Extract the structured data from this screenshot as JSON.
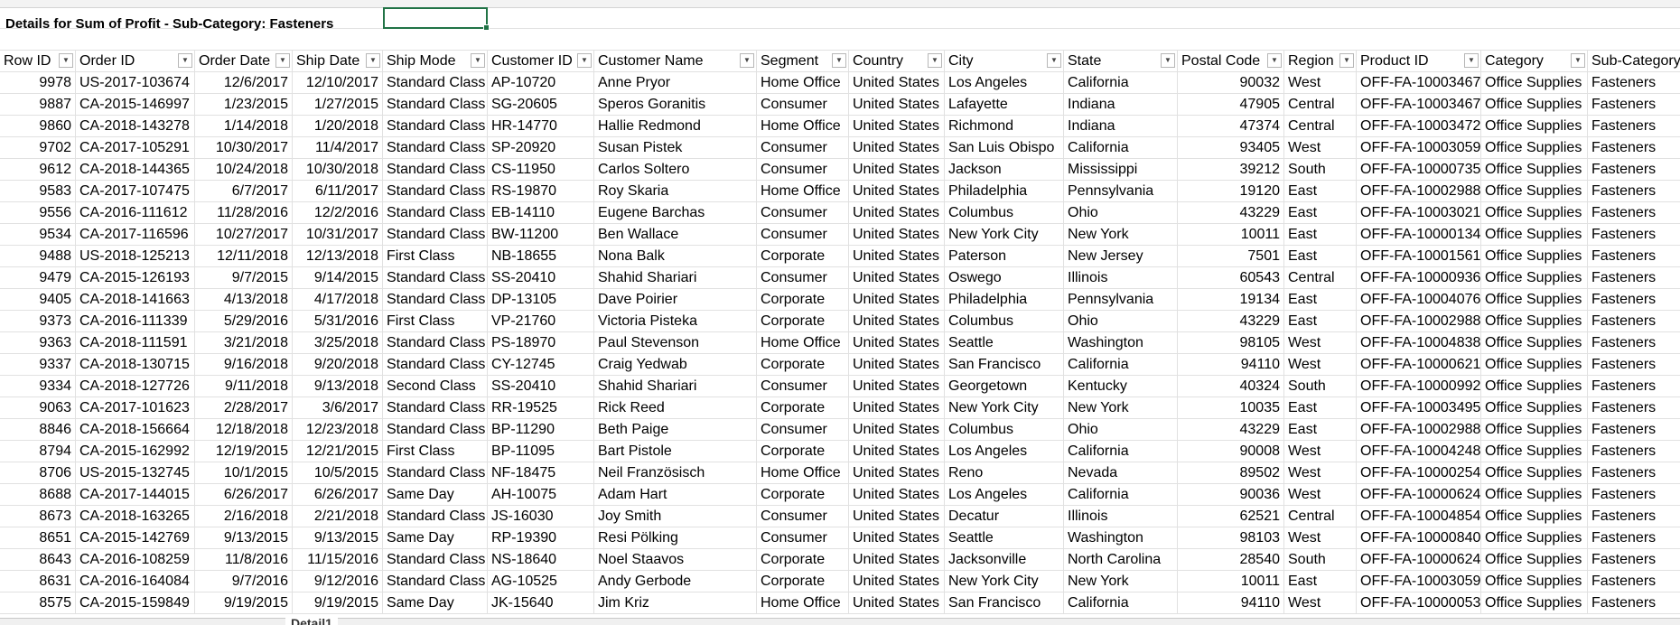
{
  "report": {
    "title": "Details for Sum of Profit - Sub-Category: Fasteners"
  },
  "columns": [
    "Row ID",
    "Order ID",
    "Order Date",
    "Ship Date",
    "Ship Mode",
    "Customer ID",
    "Customer Name",
    "Segment",
    "Country",
    "City",
    "State",
    "Postal Code",
    "Region",
    "Product ID",
    "Category",
    "Sub-Category"
  ],
  "rows": [
    [
      "9978",
      "US-2017-103674",
      "12/6/2017",
      "12/10/2017",
      "Standard Class",
      "AP-10720",
      "Anne Pryor",
      "Home Office",
      "United States",
      "Los Angeles",
      "California",
      "90032",
      "West",
      "OFF-FA-10003467",
      "Office Supplies",
      "Fasteners"
    ],
    [
      "9887",
      "CA-2015-146997",
      "1/23/2015",
      "1/27/2015",
      "Standard Class",
      "SG-20605",
      "Speros Goranitis",
      "Consumer",
      "United States",
      "Lafayette",
      "Indiana",
      "47905",
      "Central",
      "OFF-FA-10003467",
      "Office Supplies",
      "Fasteners"
    ],
    [
      "9860",
      "CA-2018-143278",
      "1/14/2018",
      "1/20/2018",
      "Standard Class",
      "HR-14770",
      "Hallie Redmond",
      "Home Office",
      "United States",
      "Richmond",
      "Indiana",
      "47374",
      "Central",
      "OFF-FA-10003472",
      "Office Supplies",
      "Fasteners"
    ],
    [
      "9702",
      "CA-2017-105291",
      "10/30/2017",
      "11/4/2017",
      "Standard Class",
      "SP-20920",
      "Susan Pistek",
      "Consumer",
      "United States",
      "San Luis Obispo",
      "California",
      "93405",
      "West",
      "OFF-FA-10003059",
      "Office Supplies",
      "Fasteners"
    ],
    [
      "9612",
      "CA-2018-144365",
      "10/24/2018",
      "10/30/2018",
      "Standard Class",
      "CS-11950",
      "Carlos Soltero",
      "Consumer",
      "United States",
      "Jackson",
      "Mississippi",
      "39212",
      "South",
      "OFF-FA-10000735",
      "Office Supplies",
      "Fasteners"
    ],
    [
      "9583",
      "CA-2017-107475",
      "6/7/2017",
      "6/11/2017",
      "Standard Class",
      "RS-19870",
      "Roy Skaria",
      "Home Office",
      "United States",
      "Philadelphia",
      "Pennsylvania",
      "19120",
      "East",
      "OFF-FA-10002988",
      "Office Supplies",
      "Fasteners"
    ],
    [
      "9556",
      "CA-2016-111612",
      "11/28/2016",
      "12/2/2016",
      "Standard Class",
      "EB-14110",
      "Eugene Barchas",
      "Consumer",
      "United States",
      "Columbus",
      "Ohio",
      "43229",
      "East",
      "OFF-FA-10003021",
      "Office Supplies",
      "Fasteners"
    ],
    [
      "9534",
      "CA-2017-116596",
      "10/27/2017",
      "10/31/2017",
      "Standard Class",
      "BW-11200",
      "Ben Wallace",
      "Consumer",
      "United States",
      "New York City",
      "New York",
      "10011",
      "East",
      "OFF-FA-10000134",
      "Office Supplies",
      "Fasteners"
    ],
    [
      "9488",
      "US-2018-125213",
      "12/11/2018",
      "12/13/2018",
      "First Class",
      "NB-18655",
      "Nona Balk",
      "Corporate",
      "United States",
      "Paterson",
      "New Jersey",
      "7501",
      "East",
      "OFF-FA-10001561",
      "Office Supplies",
      "Fasteners"
    ],
    [
      "9479",
      "CA-2015-126193",
      "9/7/2015",
      "9/14/2015",
      "Standard Class",
      "SS-20410",
      "Shahid Shariari",
      "Consumer",
      "United States",
      "Oswego",
      "Illinois",
      "60543",
      "Central",
      "OFF-FA-10000936",
      "Office Supplies",
      "Fasteners"
    ],
    [
      "9405",
      "CA-2018-141663",
      "4/13/2018",
      "4/17/2018",
      "Standard Class",
      "DP-13105",
      "Dave Poirier",
      "Corporate",
      "United States",
      "Philadelphia",
      "Pennsylvania",
      "19134",
      "East",
      "OFF-FA-10004076",
      "Office Supplies",
      "Fasteners"
    ],
    [
      "9373",
      "CA-2016-111339",
      "5/29/2016",
      "5/31/2016",
      "First Class",
      "VP-21760",
      "Victoria Pisteka",
      "Corporate",
      "United States",
      "Columbus",
      "Ohio",
      "43229",
      "East",
      "OFF-FA-10002988",
      "Office Supplies",
      "Fasteners"
    ],
    [
      "9363",
      "CA-2018-111591",
      "3/21/2018",
      "3/25/2018",
      "Standard Class",
      "PS-18970",
      "Paul Stevenson",
      "Home Office",
      "United States",
      "Seattle",
      "Washington",
      "98105",
      "West",
      "OFF-FA-10004838",
      "Office Supplies",
      "Fasteners"
    ],
    [
      "9337",
      "CA-2018-130715",
      "9/16/2018",
      "9/20/2018",
      "Standard Class",
      "CY-12745",
      "Craig Yedwab",
      "Corporate",
      "United States",
      "San Francisco",
      "California",
      "94110",
      "West",
      "OFF-FA-10000621",
      "Office Supplies",
      "Fasteners"
    ],
    [
      "9334",
      "CA-2018-127726",
      "9/11/2018",
      "9/13/2018",
      "Second Class",
      "SS-20410",
      "Shahid Shariari",
      "Consumer",
      "United States",
      "Georgetown",
      "Kentucky",
      "40324",
      "South",
      "OFF-FA-10000992",
      "Office Supplies",
      "Fasteners"
    ],
    [
      "9063",
      "CA-2017-101623",
      "2/28/2017",
      "3/6/2017",
      "Standard Class",
      "RR-19525",
      "Rick Reed",
      "Corporate",
      "United States",
      "New York City",
      "New York",
      "10035",
      "East",
      "OFF-FA-10003495",
      "Office Supplies",
      "Fasteners"
    ],
    [
      "8846",
      "CA-2018-156664",
      "12/18/2018",
      "12/23/2018",
      "Standard Class",
      "BP-11290",
      "Beth Paige",
      "Consumer",
      "United States",
      "Columbus",
      "Ohio",
      "43229",
      "East",
      "OFF-FA-10002988",
      "Office Supplies",
      "Fasteners"
    ],
    [
      "8794",
      "CA-2015-162992",
      "12/19/2015",
      "12/21/2015",
      "First Class",
      "BP-11095",
      "Bart Pistole",
      "Corporate",
      "United States",
      "Los Angeles",
      "California",
      "90008",
      "West",
      "OFF-FA-10004248",
      "Office Supplies",
      "Fasteners"
    ],
    [
      "8706",
      "US-2015-132745",
      "10/1/2015",
      "10/5/2015",
      "Standard Class",
      "NF-18475",
      "Neil Französisch",
      "Home Office",
      "United States",
      "Reno",
      "Nevada",
      "89502",
      "West",
      "OFF-FA-10000254",
      "Office Supplies",
      "Fasteners"
    ],
    [
      "8688",
      "CA-2017-144015",
      "6/26/2017",
      "6/26/2017",
      "Same Day",
      "AH-10075",
      "Adam Hart",
      "Corporate",
      "United States",
      "Los Angeles",
      "California",
      "90036",
      "West",
      "OFF-FA-10000624",
      "Office Supplies",
      "Fasteners"
    ],
    [
      "8673",
      "CA-2018-163265",
      "2/16/2018",
      "2/21/2018",
      "Standard Class",
      "JS-16030",
      "Joy Smith",
      "Consumer",
      "United States",
      "Decatur",
      "Illinois",
      "62521",
      "Central",
      "OFF-FA-10004854",
      "Office Supplies",
      "Fasteners"
    ],
    [
      "8651",
      "CA-2015-142769",
      "9/13/2015",
      "9/13/2015",
      "Same Day",
      "RP-19390",
      "Resi Pölking",
      "Consumer",
      "United States",
      "Seattle",
      "Washington",
      "98103",
      "West",
      "OFF-FA-10000840",
      "Office Supplies",
      "Fasteners"
    ],
    [
      "8643",
      "CA-2016-108259",
      "11/8/2016",
      "11/15/2016",
      "Standard Class",
      "NS-18640",
      "Noel Staavos",
      "Corporate",
      "United States",
      "Jacksonville",
      "North Carolina",
      "28540",
      "South",
      "OFF-FA-10000624",
      "Office Supplies",
      "Fasteners"
    ],
    [
      "8631",
      "CA-2016-164084",
      "9/7/2016",
      "9/12/2016",
      "Standard Class",
      "AG-10525",
      "Andy Gerbode",
      "Corporate",
      "United States",
      "New York City",
      "New York",
      "10011",
      "East",
      "OFF-FA-10003059",
      "Office Supplies",
      "Fasteners"
    ],
    [
      "8575",
      "CA-2015-159849",
      "9/19/2015",
      "9/19/2015",
      "Same Day",
      "JK-15640",
      "Jim Kriz",
      "Home Office",
      "United States",
      "San Francisco",
      "California",
      "94110",
      "West",
      "OFF-FA-10000053",
      "Office Supplies",
      "Fasteners"
    ]
  ],
  "sheet_tabs": {
    "active_label": "Detail1"
  },
  "colors": {
    "grid": "#e1e1e1",
    "selection": "#217346"
  }
}
